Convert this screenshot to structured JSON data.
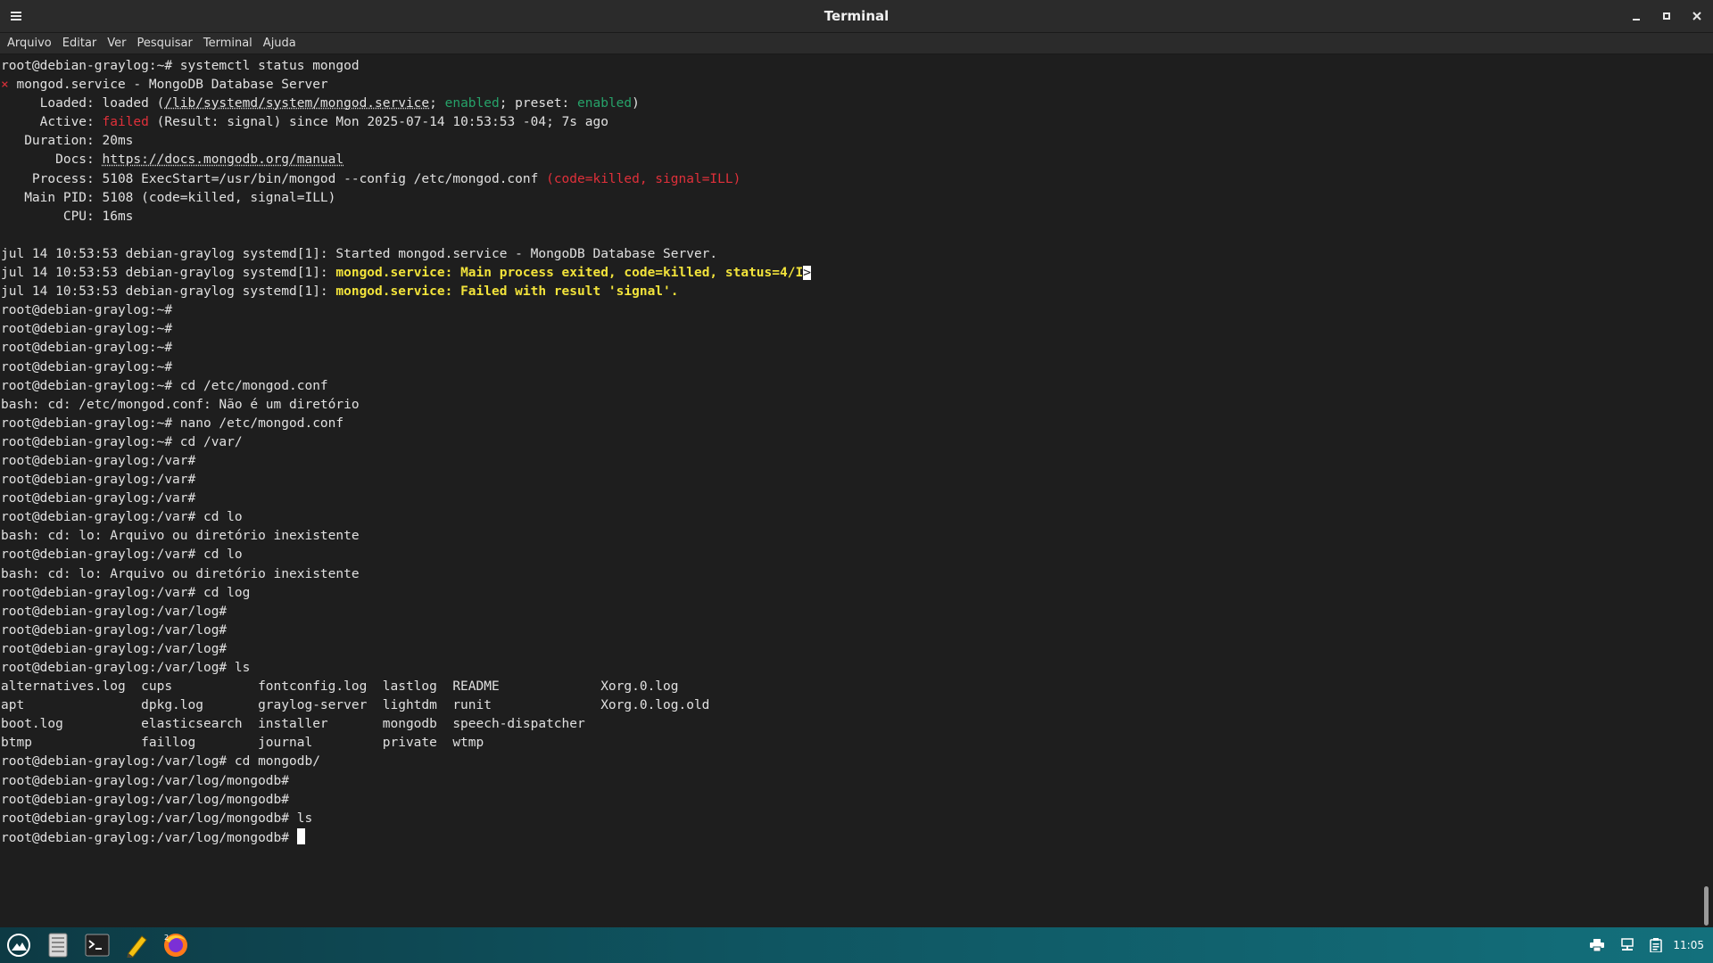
{
  "window": {
    "title": "Terminal",
    "menu_icon": "hamburger-menu-icon",
    "controls": [
      "minimize-icon",
      "maximize-icon",
      "close-icon"
    ]
  },
  "menubar": {
    "items": [
      "Arquivo",
      "Editar",
      "Ver",
      "Pesquisar",
      "Terminal",
      "Ajuda"
    ]
  },
  "colors": {
    "background": "#1e1e1e",
    "foreground": "#e0e0e0",
    "error_red": "#e0303a",
    "ok_green": "#26a269",
    "warn_yellow": "#f2e33b",
    "taskbar": "#0f5561"
  },
  "terminal": {
    "lines": [
      [
        {
          "t": "root@debian-graylog:~# systemctl status mongod"
        }
      ],
      [
        {
          "t": "×",
          "c": "red"
        },
        {
          "t": " mongod.service - MongoDB Database Server"
        }
      ],
      [
        {
          "t": "     Loaded: loaded ("
        },
        {
          "t": "/lib/systemd/system/mongod.service",
          "c": "und"
        },
        {
          "t": "; "
        },
        {
          "t": "enabled",
          "c": "green"
        },
        {
          "t": "; preset: "
        },
        {
          "t": "enabled",
          "c": "green"
        },
        {
          "t": ")"
        }
      ],
      [
        {
          "t": "     Active: "
        },
        {
          "t": "failed",
          "c": "red"
        },
        {
          "t": " (Result: signal) since Mon 2025-07-14 10:53:53 -04; 7s ago"
        }
      ],
      [
        {
          "t": "   Duration: 20ms"
        }
      ],
      [
        {
          "t": "       Docs: "
        },
        {
          "t": "https://docs.mongodb.org/manual",
          "c": "und"
        }
      ],
      [
        {
          "t": "    Process: 5108 ExecStart=/usr/bin/mongod --config /etc/mongod.conf "
        },
        {
          "t": "(code=killed, signal=ILL)",
          "c": "red"
        }
      ],
      [
        {
          "t": "   Main PID: 5108 (code=killed, signal=ILL)"
        }
      ],
      [
        {
          "t": "        CPU: 16ms"
        }
      ],
      [
        {
          "t": ""
        }
      ],
      [
        {
          "t": "jul 14 10:53:53 debian-graylog systemd[1]: Started mongod.service - MongoDB Database Server."
        }
      ],
      [
        {
          "t": "jul 14 10:53:53 debian-graylog systemd[1]: "
        },
        {
          "t": "mongod.service: Main process exited, code=killed, status=4/I",
          "c": "yellow"
        },
        {
          "t": ">",
          "c": "inv"
        }
      ],
      [
        {
          "t": "jul 14 10:53:53 debian-graylog systemd[1]: "
        },
        {
          "t": "mongod.service: Failed with result 'signal'.",
          "c": "yellow"
        }
      ],
      [
        {
          "t": "root@debian-graylog:~#"
        }
      ],
      [
        {
          "t": "root@debian-graylog:~#"
        }
      ],
      [
        {
          "t": "root@debian-graylog:~#"
        }
      ],
      [
        {
          "t": "root@debian-graylog:~#"
        }
      ],
      [
        {
          "t": "root@debian-graylog:~# cd /etc/mongod.conf"
        }
      ],
      [
        {
          "t": "bash: cd: /etc/mongod.conf: Não é um diretório"
        }
      ],
      [
        {
          "t": "root@debian-graylog:~# nano /etc/mongod.conf"
        }
      ],
      [
        {
          "t": "root@debian-graylog:~# cd /var/"
        }
      ],
      [
        {
          "t": "root@debian-graylog:/var#"
        }
      ],
      [
        {
          "t": "root@debian-graylog:/var#"
        }
      ],
      [
        {
          "t": "root@debian-graylog:/var#"
        }
      ],
      [
        {
          "t": "root@debian-graylog:/var# cd lo"
        }
      ],
      [
        {
          "t": "bash: cd: lo: Arquivo ou diretório inexistente"
        }
      ],
      [
        {
          "t": "root@debian-graylog:/var# cd lo"
        }
      ],
      [
        {
          "t": "bash: cd: lo: Arquivo ou diretório inexistente"
        }
      ],
      [
        {
          "t": "root@debian-graylog:/var# cd log"
        }
      ],
      [
        {
          "t": "root@debian-graylog:/var/log#"
        }
      ],
      [
        {
          "t": "root@debian-graylog:/var/log#"
        }
      ],
      [
        {
          "t": "root@debian-graylog:/var/log#"
        }
      ],
      [
        {
          "t": "root@debian-graylog:/var/log# ls"
        }
      ],
      [
        {
          "t": "alternatives.log  cups           fontconfig.log  lastlog  README             Xorg.0.log"
        }
      ],
      [
        {
          "t": "apt               dpkg.log       graylog-server  lightdm  runit              Xorg.0.log.old"
        }
      ],
      [
        {
          "t": "boot.log          elasticsearch  installer       mongodb  speech-dispatcher"
        }
      ],
      [
        {
          "t": "btmp              faillog        journal         private  wtmp"
        }
      ],
      [
        {
          "t": "root@debian-graylog:/var/log# cd mongodb/"
        }
      ],
      [
        {
          "t": "root@debian-graylog:/var/log/mongodb#"
        }
      ],
      [
        {
          "t": "root@debian-graylog:/var/log/mongodb#"
        }
      ],
      [
        {
          "t": "root@debian-graylog:/var/log/mongodb# ls"
        }
      ],
      [
        {
          "t": "root@debian-graylog:/var/log/mongodb# "
        },
        {
          "t": "",
          "c": "cursor"
        }
      ]
    ]
  },
  "taskbar": {
    "launchers": [
      {
        "name": "app-menu-icon"
      },
      {
        "name": "file-manager-icon"
      },
      {
        "name": "terminal-icon"
      },
      {
        "name": "text-editor-icon"
      },
      {
        "name": "firefox-icon"
      }
    ],
    "tray": [
      "printer-icon",
      "network-icon",
      "clipboard-icon"
    ],
    "clock": "11:05"
  }
}
